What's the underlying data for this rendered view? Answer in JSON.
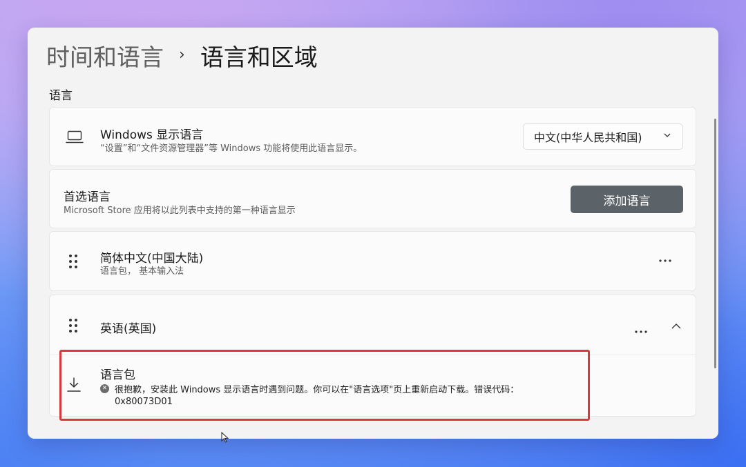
{
  "breadcrumb": {
    "parent": "时间和语言",
    "separator": "›",
    "current": "语言和区域"
  },
  "section": {
    "label": "语言"
  },
  "display_language": {
    "title": "Windows 显示语言",
    "description": "“设置”和“文件资源管理器”等 Windows 功能将使用此语言显示。",
    "selected": "中文(中华人民共和国)"
  },
  "preferred": {
    "title": "首选语言",
    "description": "Microsoft Store 应用将以此列表中支持的第一种语言显示",
    "add_label": "添加语言"
  },
  "languages": [
    {
      "name": "简体中文(中国大陆)",
      "features": "语言包， 基本输入法"
    },
    {
      "name": "英语(英国)"
    }
  ],
  "language_pack": {
    "title": "语言包",
    "error_message": "很抱歉，安装此 Windows 显示语言时遇到问题。你可以在\"语言选项\"页上重新启动下载。错误代码：",
    "error_code": "0x80073D01"
  },
  "icons": {
    "display": "laptop-icon",
    "dropdown": "chevron-down-icon",
    "grip": "drag-handle-icon",
    "more": "more-icon",
    "collapse": "chevron-up-icon",
    "download": "download-icon",
    "error": "error-icon"
  },
  "colors": {
    "accent_button": "#5c6368",
    "highlight_border": "#d9383f",
    "window_background": "#f3f3f3"
  }
}
